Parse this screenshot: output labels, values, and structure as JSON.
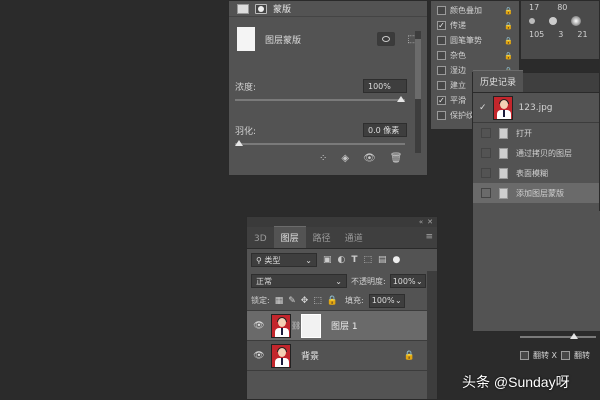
{
  "properties": {
    "header_label": "蒙版",
    "mask_label": "图层蒙版",
    "density_label": "浓度:",
    "density_value": "100%",
    "feather_label": "羽化:",
    "feather_value": "0.0 像素"
  },
  "styles_list": {
    "items": [
      {
        "label": "颜色叠加",
        "checked": false
      },
      {
        "label": "传递",
        "checked": true
      },
      {
        "label": "圆笔筆势",
        "checked": false
      },
      {
        "label": "杂色",
        "checked": false
      },
      {
        "label": "湿边",
        "checked": false
      },
      {
        "label": "建立",
        "checked": false
      },
      {
        "label": "平滑",
        "checked": true
      },
      {
        "label": "保护纹",
        "checked": false
      }
    ]
  },
  "brush_sizes": {
    "row1": [
      "17",
      "80"
    ],
    "row2": [
      "105",
      "3",
      "21"
    ]
  },
  "history": {
    "title": "历史记录",
    "snapshot_name": "123.jpg",
    "items": [
      "打开",
      "通过拷贝的图层",
      "表面模糊",
      "添加图层蒙版"
    ]
  },
  "layers": {
    "tabs": [
      "3D",
      "图层",
      "路径",
      "通道"
    ],
    "filter_kind": "类型",
    "blend_mode": "正常",
    "opacity_label": "不透明度:",
    "opacity_value": "100%",
    "lock_label": "锁定:",
    "fill_label": "填充:",
    "fill_value": "100%",
    "rows": [
      {
        "name": "图层 1"
      },
      {
        "name": "背景"
      }
    ]
  },
  "right_bottom": {
    "check1": "翻转 X",
    "check2": "翻转"
  },
  "watermark": "头条 @Sunday呀",
  "colors": {
    "panel": "#535353",
    "bg": "#2b2b2b",
    "accent_red": "#c3262c"
  }
}
